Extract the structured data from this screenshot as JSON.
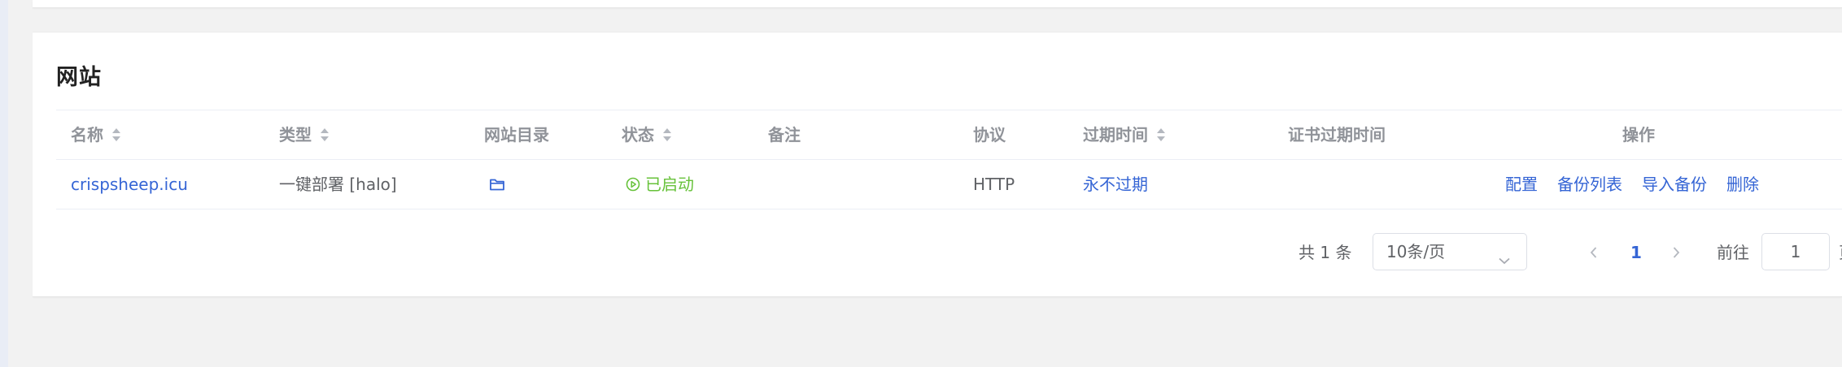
{
  "card": {
    "title": "网站"
  },
  "table": {
    "columns": [
      {
        "key": "name",
        "label": "名称",
        "sortable": true
      },
      {
        "key": "type",
        "label": "类型",
        "sortable": true
      },
      {
        "key": "dir",
        "label": "网站目录",
        "sortable": false
      },
      {
        "key": "status",
        "label": "状态",
        "sortable": true
      },
      {
        "key": "remark",
        "label": "备注",
        "sortable": false
      },
      {
        "key": "protocol",
        "label": "协议",
        "sortable": false
      },
      {
        "key": "expire",
        "label": "过期时间",
        "sortable": true
      },
      {
        "key": "ssl_expire",
        "label": "证书过期时间",
        "sortable": false
      },
      {
        "key": "ops",
        "label": "操作",
        "sortable": false
      }
    ],
    "rows": [
      {
        "name": "crispsheep.icu",
        "type": "一键部署 [halo]",
        "dir_icon": "folder-icon",
        "status": "已启动",
        "status_icon": "play-circle-icon",
        "remark": "",
        "protocol": "HTTP",
        "expire": "永不过期",
        "ssl_expire": "",
        "ops": [
          "配置",
          "备份列表",
          "导入备份",
          "删除"
        ]
      }
    ]
  },
  "pagination": {
    "total_text": "共 1 条",
    "page_size": "10条/页",
    "current_page": "1",
    "goto_label": "前往",
    "goto_value": "1",
    "goto_unit": "页"
  },
  "colors": {
    "link": "#3565d5",
    "status_running": "#67c23a",
    "header_text": "#909399",
    "body_text": "#606266"
  }
}
